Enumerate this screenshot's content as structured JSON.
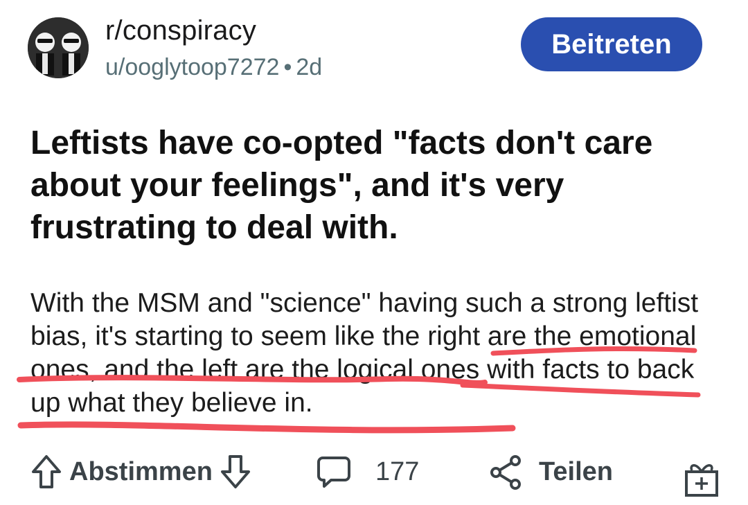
{
  "header": {
    "subreddit": "r/conspiracy",
    "author": "u/ooglytoop7272",
    "separator": "•",
    "age": "2d",
    "join_label": "Beitreten"
  },
  "post": {
    "title": "Leftists have co-opted \"facts don't care about your feelings\", and it's very frustrating to deal with.",
    "body": "With the MSM and \"science\" having such a strong leftist bias, it's starting to seem like the right are the emotional ones, and the left are the logical ones with facts to back up what they believe in."
  },
  "actions": {
    "vote_label": "Abstimmen",
    "comment_count": "177",
    "share_label": "Teilen"
  },
  "colors": {
    "join_button": "#2a4fb0",
    "underline": "#f0505a",
    "icon": "#3b4348"
  },
  "icons": [
    "upvote-icon",
    "downvote-icon",
    "comment-icon",
    "share-icon",
    "award-icon"
  ]
}
